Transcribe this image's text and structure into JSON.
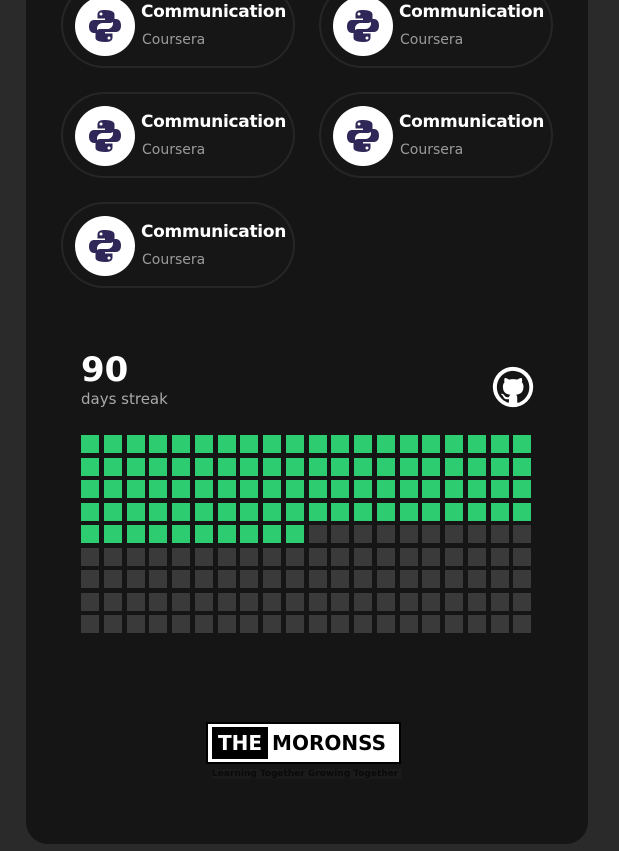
{
  "courses": [
    {
      "title": "Communication",
      "provider": "Coursera",
      "icon": "python-icon"
    },
    {
      "title": "Communication",
      "provider": "Coursera",
      "icon": "python-icon"
    },
    {
      "title": "Communication",
      "provider": "Coursera",
      "icon": "python-icon"
    },
    {
      "title": "Communication",
      "provider": "Coursera",
      "icon": "python-icon"
    },
    {
      "title": "Communication",
      "provider": "Coursera",
      "icon": "python-icon"
    }
  ],
  "streak": {
    "count": "90",
    "label": "days streak",
    "icon": "github-icon",
    "total_days": 180,
    "active_days": 90,
    "active_color": "#2ecc71",
    "inactive_color": "#3a3a3a"
  },
  "brand": {
    "the": "THE",
    "name": "MORONSS",
    "tagline": "Learning Together Growing Together"
  }
}
